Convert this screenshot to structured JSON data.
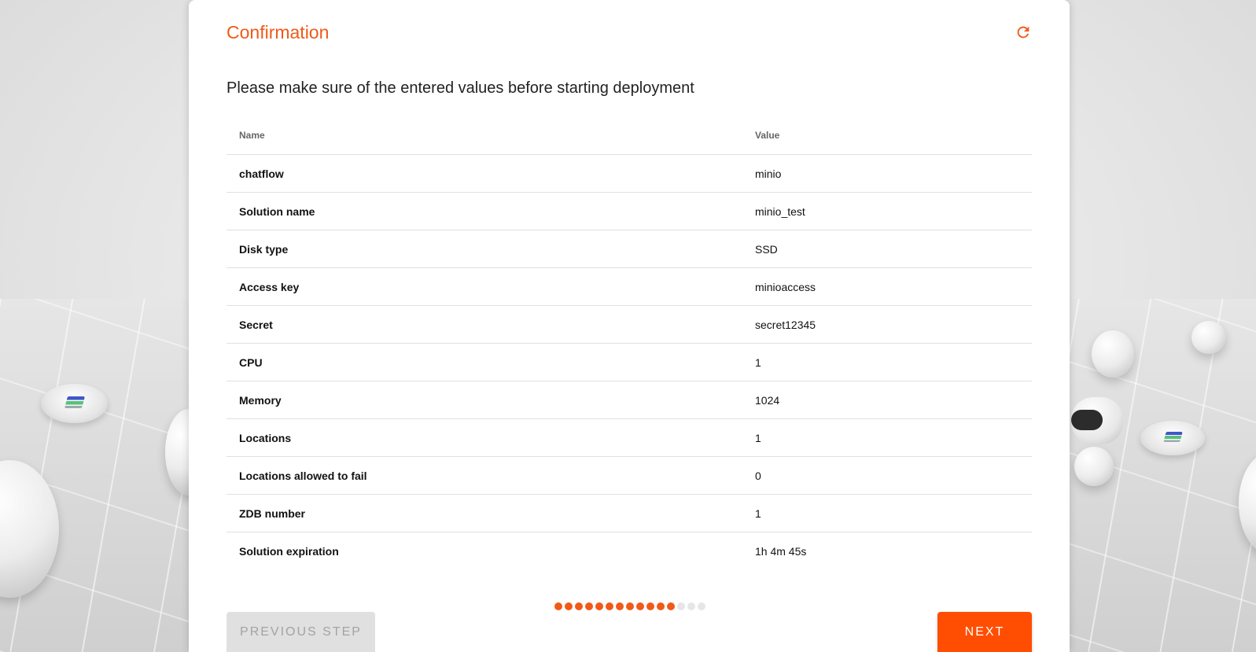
{
  "header": {
    "title": "Confirmation",
    "refresh_icon": "refresh-icon"
  },
  "subtitle": "Please make sure of the entered values before starting deployment",
  "table": {
    "columns": [
      "Name",
      "Value"
    ],
    "rows": [
      {
        "name": "chatflow",
        "value": "minio"
      },
      {
        "name": "Solution name",
        "value": "minio_test"
      },
      {
        "name": "Disk type",
        "value": "SSD"
      },
      {
        "name": "Access key",
        "value": "minioaccess"
      },
      {
        "name": "Secret",
        "value": "secret12345"
      },
      {
        "name": "CPU",
        "value": "1"
      },
      {
        "name": "Memory",
        "value": "1024"
      },
      {
        "name": "Locations",
        "value": "1"
      },
      {
        "name": "Locations allowed to fail",
        "value": "0"
      },
      {
        "name": "ZDB number",
        "value": "1"
      },
      {
        "name": "Solution expiration",
        "value": "1h 4m 45s"
      }
    ]
  },
  "stepper": {
    "total": 15,
    "completed": 12
  },
  "buttons": {
    "previous_label": "PREVIOUS STEP",
    "next_label": "NEXT"
  },
  "colors": {
    "accent": "#f05a19",
    "next_button": "#ff4e02",
    "pending_step": "#e6e6e6"
  }
}
